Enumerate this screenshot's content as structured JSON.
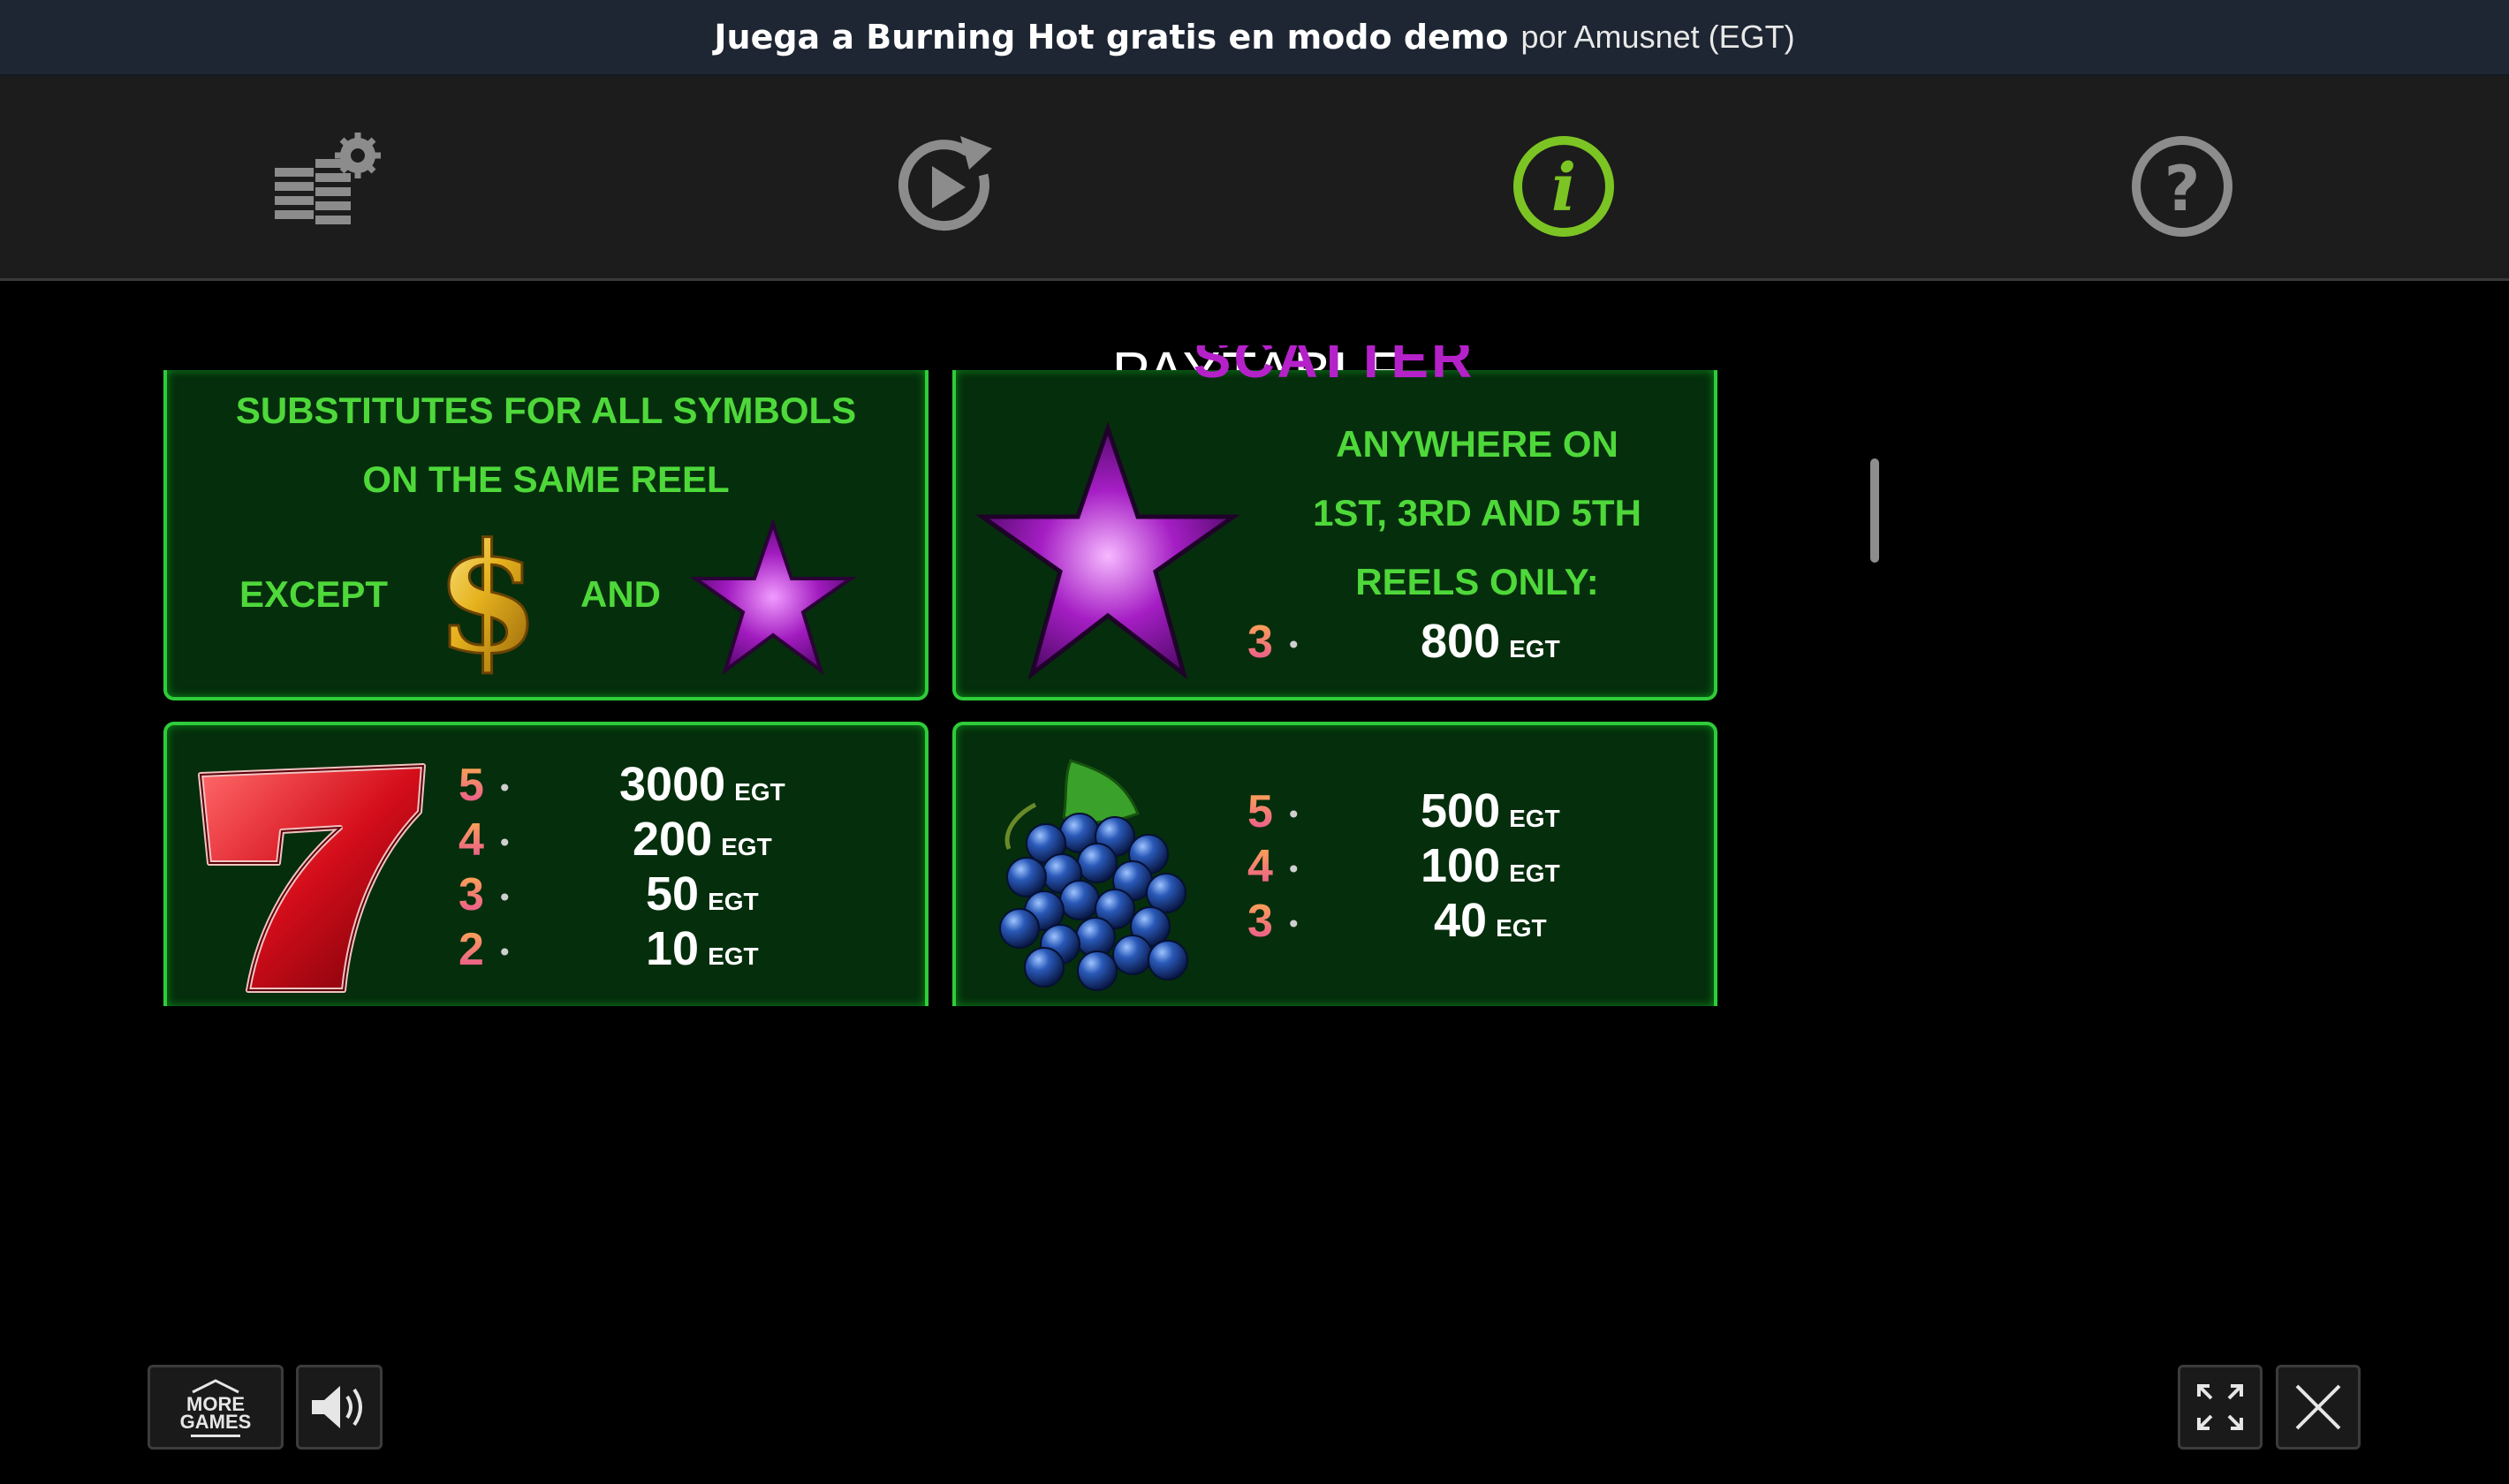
{
  "header": {
    "title": "Juega a Burning Hot gratis en modo demo",
    "provider": "por Amusnet (EGT)"
  },
  "toolbar": {
    "items": [
      {
        "icon": "bet-settings-icon"
      },
      {
        "icon": "autoplay-icon"
      },
      {
        "icon": "info-icon",
        "active": true,
        "color": "#7cc423"
      },
      {
        "icon": "help-icon"
      }
    ]
  },
  "paytable": {
    "title": "PAYTABLE",
    "scatter_title": "SCATTER",
    "wild": {
      "line1": "SUBSTITUTES FOR ALL SYMBOLS",
      "line2": "ON THE SAME REEL",
      "except": "EXCEPT",
      "and": "AND"
    },
    "scatter": {
      "line1": "ANYWHERE ON",
      "line2": "1ST, 3RD AND 5TH",
      "line3": "REELS ONLY:",
      "pays": [
        {
          "count": "3",
          "value": "800",
          "unit": "EGT"
        }
      ]
    },
    "seven": {
      "pays": [
        {
          "count": "5",
          "value": "3000",
          "unit": "EGT"
        },
        {
          "count": "4",
          "value": "200",
          "unit": "EGT"
        },
        {
          "count": "3",
          "value": "50",
          "unit": "EGT"
        },
        {
          "count": "2",
          "value": "10",
          "unit": "EGT"
        }
      ]
    },
    "grapes": {
      "pays": [
        {
          "count": "5",
          "value": "500",
          "unit": "EGT"
        },
        {
          "count": "4",
          "value": "100",
          "unit": "EGT"
        },
        {
          "count": "3",
          "value": "40",
          "unit": "EGT"
        }
      ]
    }
  },
  "controls": {
    "more_games_line1": "MORE",
    "more_games_line2": "GAMES"
  },
  "colors": {
    "panel_bg": "#052e0c",
    "panel_border": "#2fcc3a",
    "text_green": "#4ed83a",
    "scatter_purple": "#b521c9"
  }
}
